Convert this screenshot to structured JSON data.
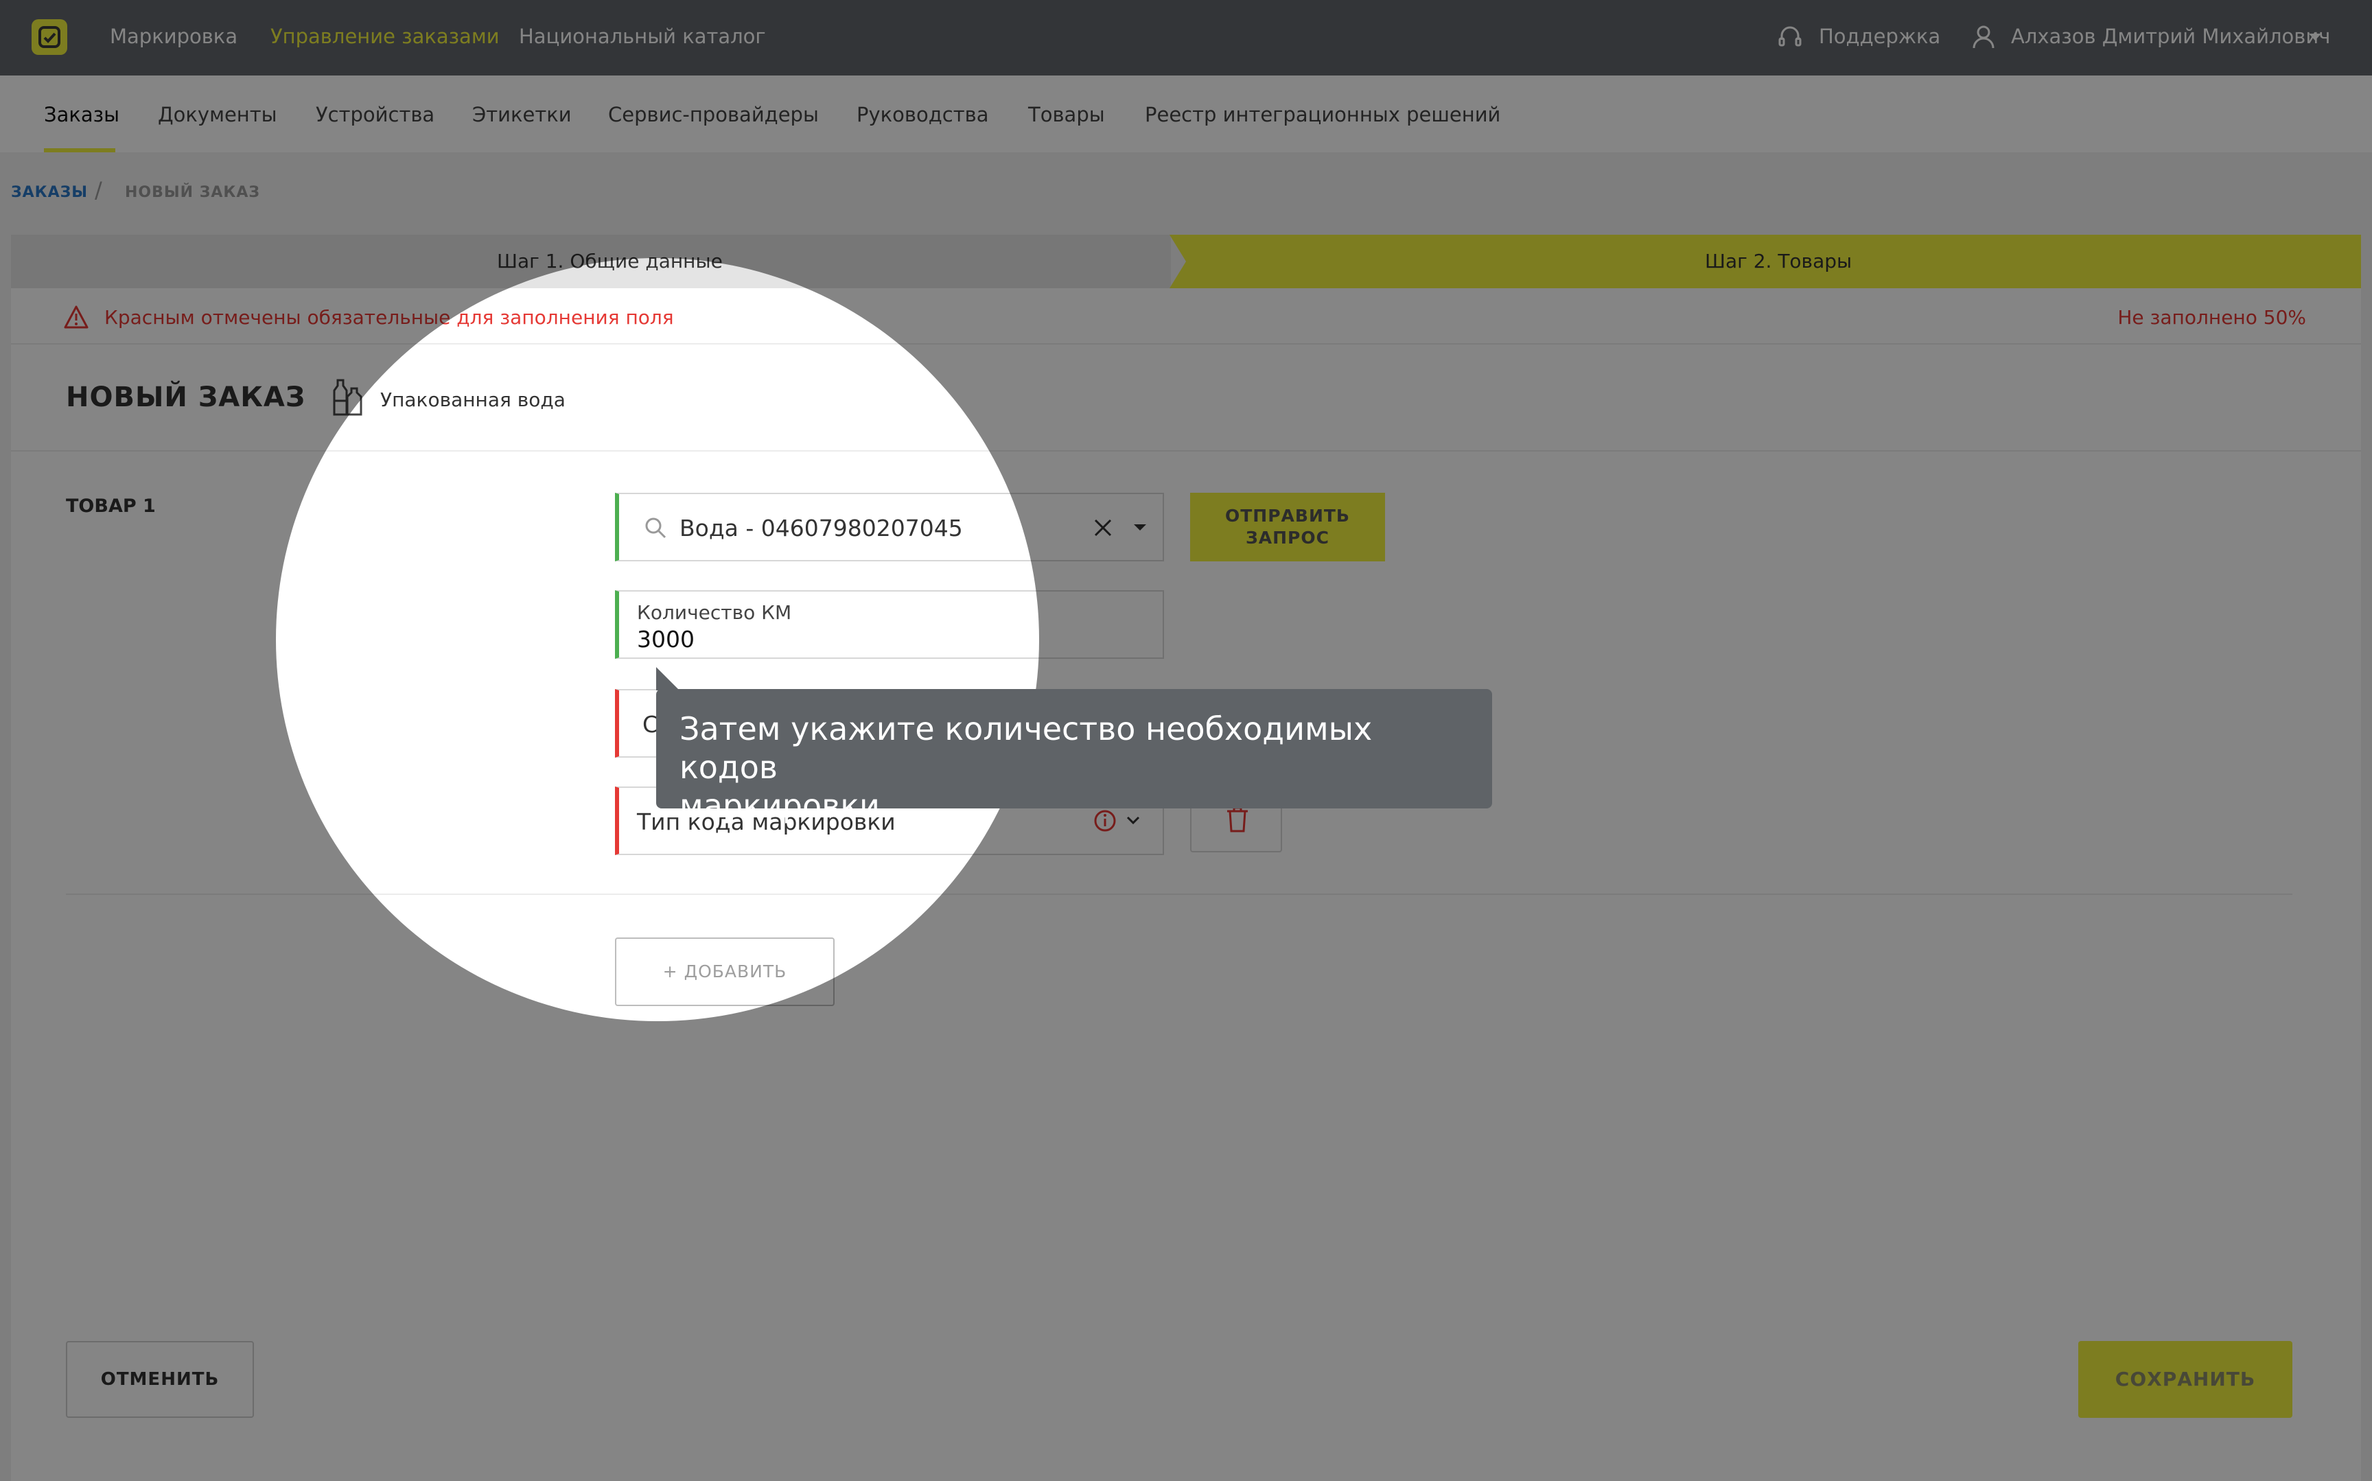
{
  "header": {
    "nav": [
      "Маркировка",
      "Управление заказами",
      "Национальный каталог"
    ],
    "active_nav": 1,
    "support_label": "Поддержка",
    "user_name": "Алхазов Дмитрий Михайлович"
  },
  "subnav": {
    "items": [
      "Заказы",
      "Документы",
      "Устройства",
      "Этикетки",
      "Сервис-провайдеры",
      "Руководства",
      "Товары",
      "Реестр интеграционных решений"
    ],
    "active": 0
  },
  "breadcrumb": {
    "link": "ЗАКАЗЫ",
    "separator": "/",
    "current": "НОВЫЙ ЗАКАЗ"
  },
  "steps": {
    "step1": "Шаг 1. Общие данные",
    "step2": "Шаг 2. Товары"
  },
  "warning": {
    "message": "Красным отмечены обязательные для заполнения поля",
    "progress": "Не заполнено 50%"
  },
  "order": {
    "title": "НОВЫЙ ЗАКАЗ",
    "category": "Упакованная вода",
    "item_label": "ТОВАР 1",
    "product_value": "Вода - 04607980207045",
    "quantity_label": "Количество КМ",
    "quantity_value": "3000",
    "third_field_visible": "С",
    "code_type_placeholder": "Тип кода маркировки",
    "send_button": "ОТПРАВИТЬ ЗАПРОС",
    "add_button": "+ ДОБАВИТЬ"
  },
  "footer": {
    "cancel": "ОТМЕНИТЬ",
    "save": "СОХРАНИТЬ"
  },
  "tooltip": {
    "line1": "Затем укажите количество необходимых кодов",
    "line2": "маркировки"
  },
  "colors": {
    "accent": "#f0ef3f",
    "error": "#e53935",
    "valid": "#4caf50",
    "link": "#2b78c5"
  },
  "icons": [
    "logo-icon",
    "headset-icon",
    "user-icon",
    "chevron-down-icon",
    "warning-icon",
    "bottle-icon",
    "search-icon",
    "close-icon",
    "info-icon",
    "trash-icon"
  ]
}
